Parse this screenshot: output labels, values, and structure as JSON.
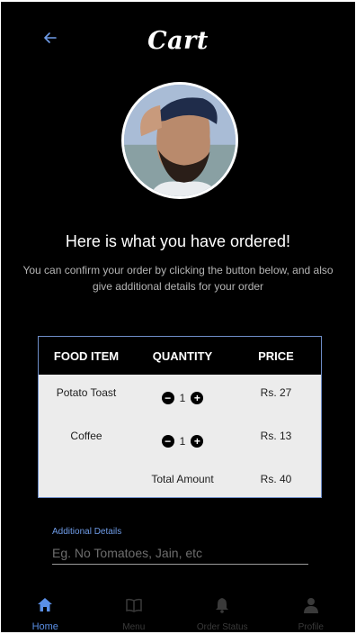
{
  "header": {
    "title": "Cart",
    "back_icon": "arrow-left-icon"
  },
  "profile": {
    "avatar_icon": "user-photo"
  },
  "message": {
    "headline": "Here is what you have ordered!",
    "description": "You can confirm your order by clicking the button below, and also give additional details for your order"
  },
  "order_table": {
    "headers": {
      "item": "FOOD ITEM",
      "quantity": "QUANTITY",
      "price": "PRICE"
    },
    "rows": [
      {
        "item": "Potato Toast",
        "quantity": "1",
        "price": "Rs. 27"
      },
      {
        "item": "Coffee",
        "quantity": "1",
        "price": "Rs. 13"
      }
    ],
    "total_label": "Total Amount",
    "total_value": "Rs. 40"
  },
  "additional_details": {
    "label": "Additional Details",
    "placeholder": "Eg. No Tomatoes, Jain, etc",
    "value": ""
  },
  "bottom_nav": {
    "items": [
      {
        "label": "Home",
        "icon": "home-icon",
        "active": true
      },
      {
        "label": "Menu",
        "icon": "book-icon",
        "active": false
      },
      {
        "label": "Order Status",
        "icon": "bell-icon",
        "active": false
      },
      {
        "label": "Profile",
        "icon": "person-icon",
        "active": false
      }
    ]
  },
  "colors": {
    "background": "#000000",
    "accent": "#5a8fe6",
    "table_background": "#ececec",
    "table_border": "#6f8ec9"
  }
}
